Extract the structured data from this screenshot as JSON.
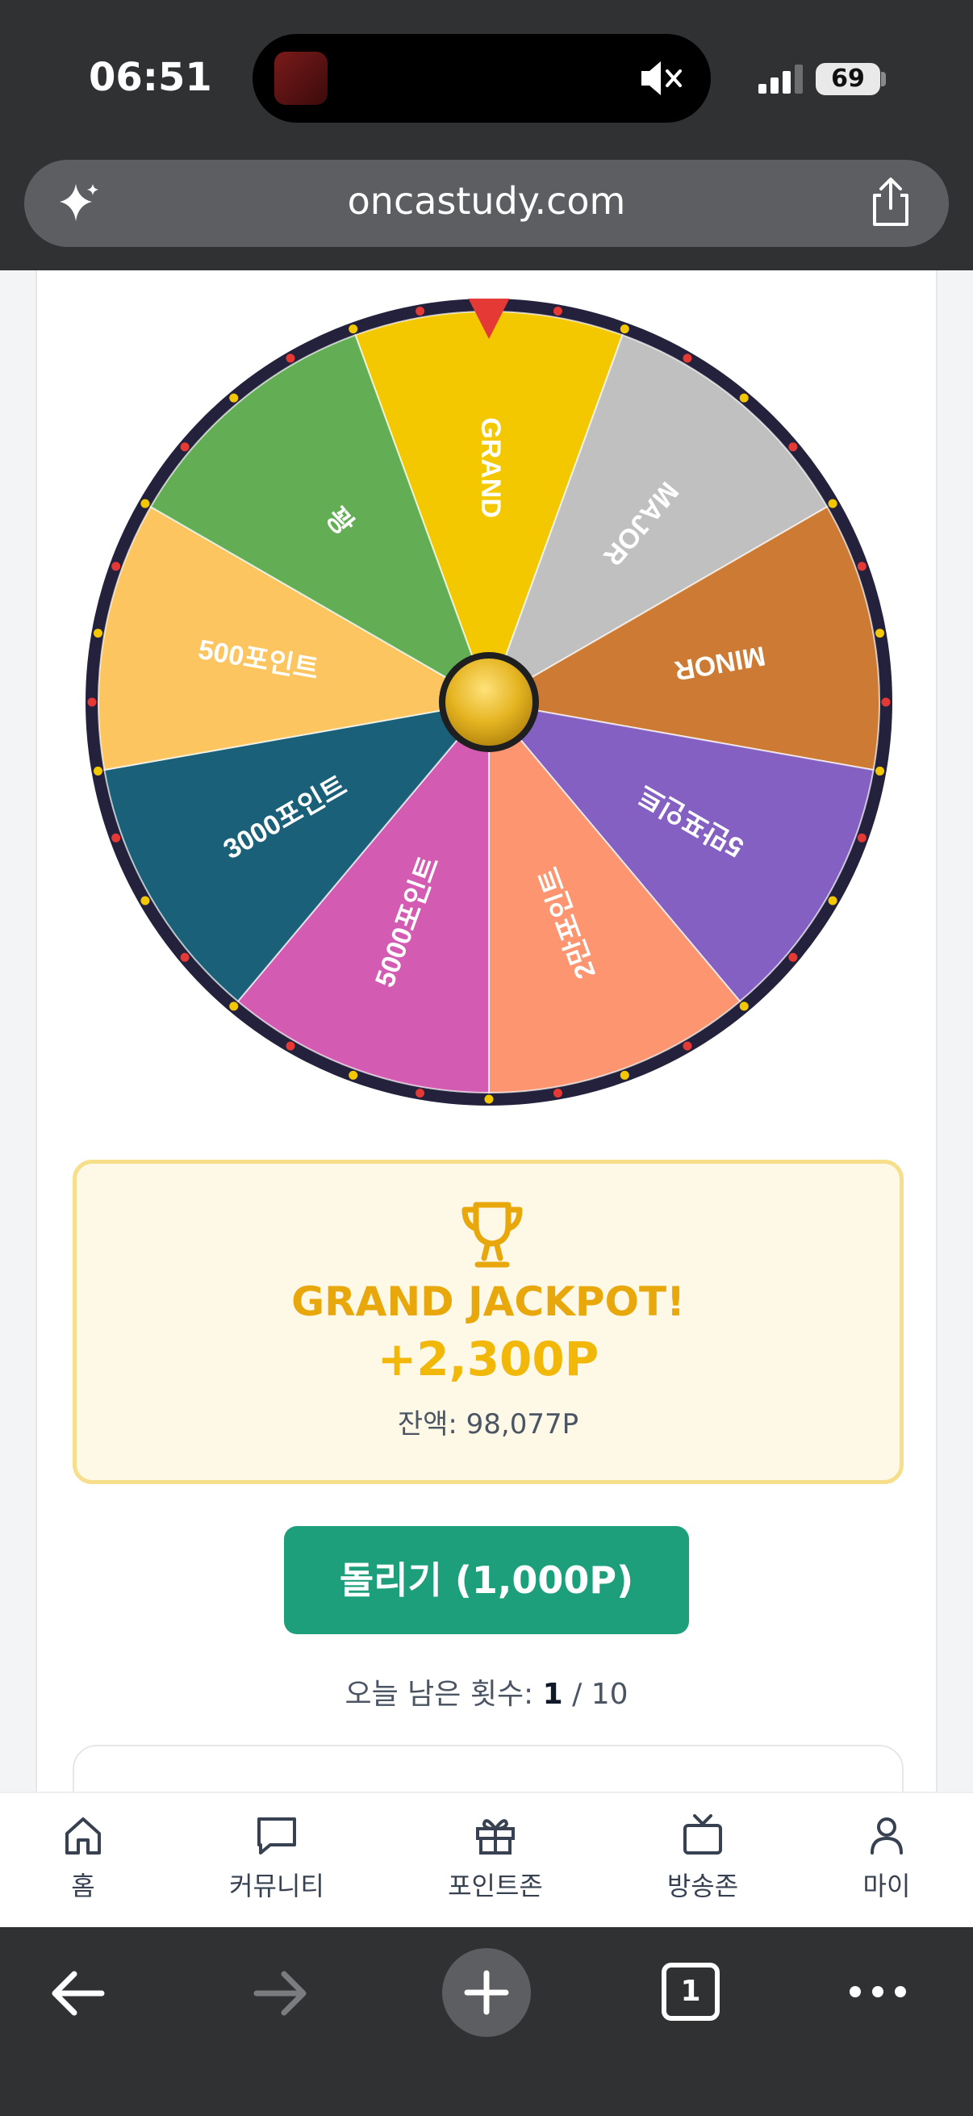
{
  "status_bar": {
    "time": "06:51",
    "battery": "69"
  },
  "browser": {
    "url": "oncastudy.com"
  },
  "wheel": {
    "segments": [
      {
        "label": "GRAND",
        "color": "#f4c800"
      },
      {
        "label": "MAJOR",
        "color": "#c0c0c0"
      },
      {
        "label": "MINOR",
        "color": "#cd7b34"
      },
      {
        "label": "5만포인트",
        "color": "#8460c2"
      },
      {
        "label": "2만포인트",
        "color": "#fd9670"
      },
      {
        "label": "5000포인트",
        "color": "#d35cb2"
      },
      {
        "label": "3000포인트",
        "color": "#1b6079"
      },
      {
        "label": "500포인트",
        "color": "#fdc560"
      },
      {
        "label": "꽝",
        "color": "#63ae55"
      }
    ],
    "rim_color": "#23213b",
    "pointer_color": "#e53935"
  },
  "result": {
    "title": "GRAND JACKPOT!",
    "amount": "+2,300P",
    "balance": "잔액: 98,077P"
  },
  "spin_button": {
    "label": "돌리기 (1,000P)"
  },
  "remaining": {
    "label": "오늘 남은 횟수: ",
    "count": "1",
    "separator": " / ",
    "total": "10"
  },
  "bottom_nav": [
    {
      "label": "홈",
      "icon": "home-icon"
    },
    {
      "label": "커뮤니티",
      "icon": "chat-icon"
    },
    {
      "label": "포인트존",
      "icon": "gift-icon"
    },
    {
      "label": "방송존",
      "icon": "tv-icon"
    },
    {
      "label": "마이",
      "icon": "user-icon"
    }
  ],
  "browser_toolbar": {
    "tab_count": "1"
  }
}
